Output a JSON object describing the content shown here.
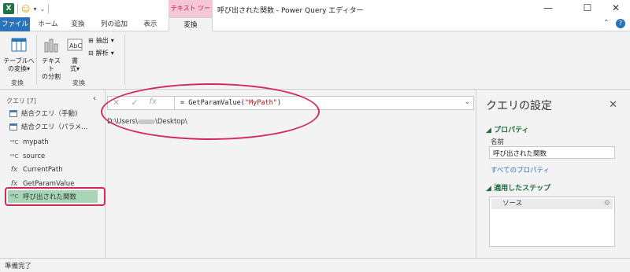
{
  "titlebar": {
    "app_icon": "X",
    "window_title": "呼び出された関数 - Power Query エディター",
    "context_tab": "テキスト ツール",
    "minimize": "—",
    "maximize": "☐",
    "close": "✕"
  },
  "ribbon_tabs": [
    "ファイル",
    "ホーム",
    "変換",
    "列の追加",
    "表示",
    "変換"
  ],
  "ribbon": {
    "to_table_label_1": "テーブルへ",
    "to_table_label_2": "の変換",
    "split_text_label_1": "テキスト",
    "split_text_label_2": "の分割",
    "format_label_1": "書",
    "format_label_2": "式",
    "extract_label": "抽出",
    "parse_label": "解析",
    "group1_label": "変換",
    "group2_label": "変換"
  },
  "queries": {
    "header": "クエリ [7]",
    "items": [
      {
        "label": "結合クエリ（手動)",
        "icon": "table-icon"
      },
      {
        "label": "結合クエリ（パラメ...",
        "icon": "table-icon"
      },
      {
        "label": "mypath",
        "icon": "abc-icon"
      },
      {
        "label": "source",
        "icon": "abc-icon"
      },
      {
        "label": "CurrentPath",
        "icon": "fx-icon"
      },
      {
        "label": "GetParamValue",
        "icon": "fx-icon"
      },
      {
        "label": "呼び出された関数",
        "icon": "abc-icon"
      }
    ]
  },
  "formula_bar": {
    "prefix": "= GetParamValue(",
    "arg": "\"MyPath\"",
    "suffix": ")"
  },
  "result": {
    "before": "D:\\Users\\",
    "after": "\\Desktop\\"
  },
  "settings": {
    "title": "クエリの設定",
    "properties_header": "プロパティ",
    "name_label": "名前",
    "name_value": "呼び出された関数",
    "all_properties_link": "すべてのプロパティ",
    "applied_steps_header": "適用したステップ",
    "steps": [
      "ソース"
    ]
  },
  "status": "準備完了",
  "colors": {
    "accent": "#2b73b8",
    "highlight": "#d22a5c",
    "selected": "#a7d5b5",
    "excel_green": "#1f7244"
  }
}
